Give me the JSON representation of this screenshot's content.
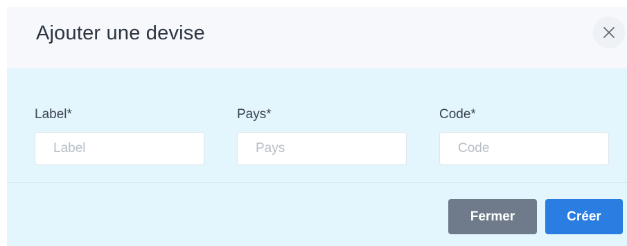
{
  "modal": {
    "title": "Ajouter une devise",
    "close_icon": "close-icon"
  },
  "form": {
    "fields": [
      {
        "label": "Label*",
        "placeholder": "Label",
        "value": ""
      },
      {
        "label": "Pays*",
        "placeholder": "Pays",
        "value": ""
      },
      {
        "label": "Code*",
        "placeholder": "Code",
        "value": ""
      }
    ]
  },
  "footer": {
    "close_label": "Fermer",
    "create_label": "Créer"
  },
  "colors": {
    "header_bg": "#f6f8fb",
    "body_bg": "#e3f5fd",
    "secondary_button": "#6f7b8a",
    "primary_button": "#2a7de1"
  }
}
